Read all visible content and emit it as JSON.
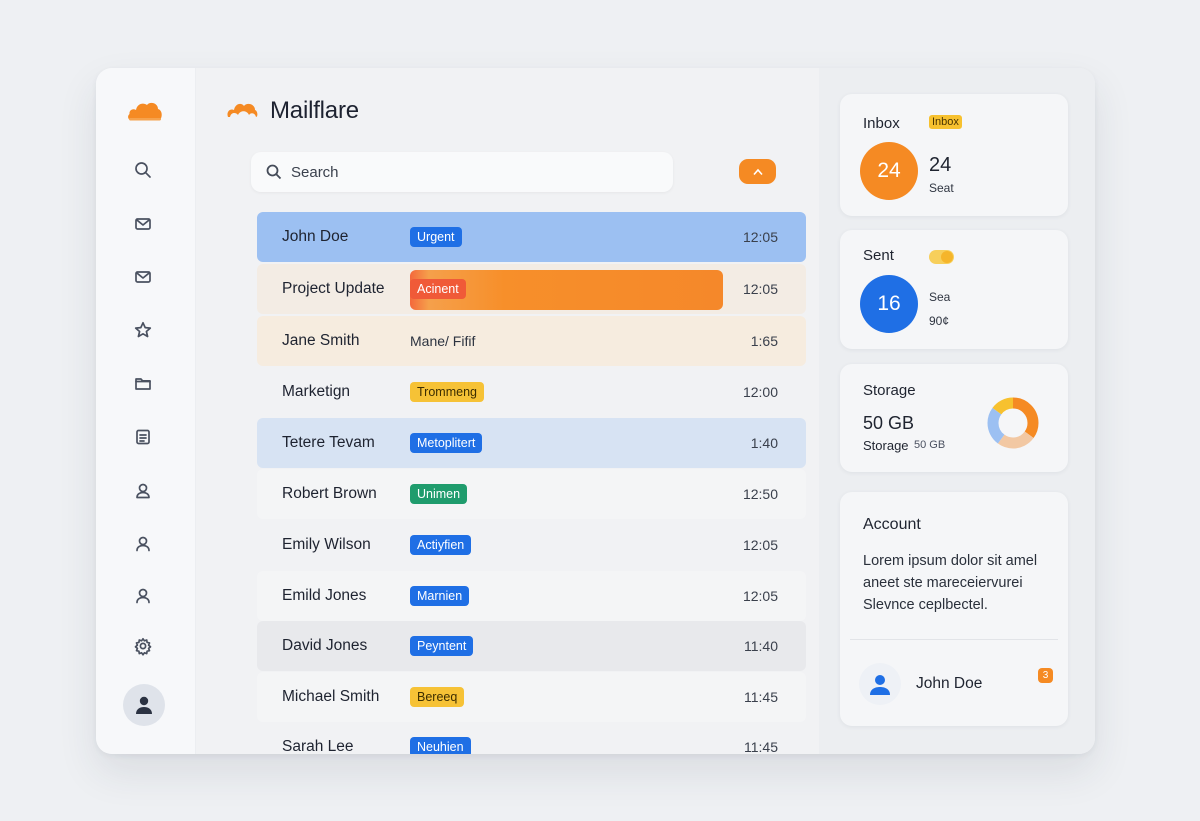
{
  "app": {
    "title": "Mailflare",
    "accent": "#f58a23"
  },
  "sidebar": {
    "icons": [
      "search-icon",
      "mail-icon",
      "mail-icon",
      "star-icon",
      "folder-icon",
      "notes-icon",
      "person-icon",
      "person-icon",
      "person-icon",
      "gear-icon"
    ]
  },
  "search": {
    "placeholder": "Search"
  },
  "emails": [
    {
      "name": "John Doe",
      "tag": "Urgent",
      "tag_color": "#1f6fe5",
      "time": "12:05",
      "row_bg": "#9cc0f2"
    },
    {
      "name": "Project Update",
      "tag": "Acinent",
      "tag_color": "#f05a38",
      "time": "12:05",
      "row_bg": "#f3ece4"
    },
    {
      "name": "Jane Smith",
      "tag": "Mane/ Fifif",
      "tag_color": "",
      "time": "1:65",
      "row_bg": "#f6ecdf"
    },
    {
      "name": "Marketign",
      "tag": "Trommeng",
      "tag_color": "#f6c236",
      "time": "12:00",
      "row_bg": "#f1f2f4"
    },
    {
      "name": "Tetere Tevam",
      "tag": "Metoplitert",
      "tag_color": "#1f6fe5",
      "time": "1:40",
      "row_bg": "#d7e3f3"
    },
    {
      "name": "Robert Brown",
      "tag": "Unimen",
      "tag_color": "#1f9c6d",
      "time": "12:50",
      "row_bg": "#f4f5f6"
    },
    {
      "name": "Emily Wilson",
      "tag": "Actiyfien",
      "tag_color": "#1f6fe5",
      "time": "12:05",
      "row_bg": "#f1f2f4"
    },
    {
      "name": "Emild Jones",
      "tag": "Marnien",
      "tag_color": "#1f6fe5",
      "time": "12:05",
      "row_bg": "#f4f5f6"
    },
    {
      "name": "David Jones",
      "tag": "Peyntent",
      "tag_color": "#1f6fe5",
      "time": "11:40",
      "row_bg": "#e8e9ec"
    },
    {
      "name": "Michael Smith",
      "tag": "Bereeq",
      "tag_color": "#f6c236",
      "time": "11:45",
      "row_bg": "#f4f5f6"
    },
    {
      "name": "Sarah Lee",
      "tag": "Neuhien",
      "tag_color": "#1f6fe5",
      "time": "11:45",
      "row_bg": "#f1f2f4"
    }
  ],
  "inbox_card": {
    "label": "Inbox",
    "badge": "Inbox",
    "count": "24",
    "count_text": "24",
    "sub": "Seat",
    "color": "#f58a23"
  },
  "sent_card": {
    "label": "Sent",
    "count": "16",
    "sub1": "Sea",
    "sub2": "90¢",
    "color": "#1f6fe5"
  },
  "storage_card": {
    "label": "Storage",
    "value": "50 GB",
    "sub_label": "Storage",
    "sub_value": "50 GB",
    "donut_segments": [
      0.35,
      0.25,
      0.25,
      0.15
    ]
  },
  "account_card": {
    "label": "Account",
    "text": "Lorem ipsum dolor sit amel aneet ste mareceiervurei Slevnce ceplbectel.",
    "user": "John Doe",
    "notification": "3"
  }
}
